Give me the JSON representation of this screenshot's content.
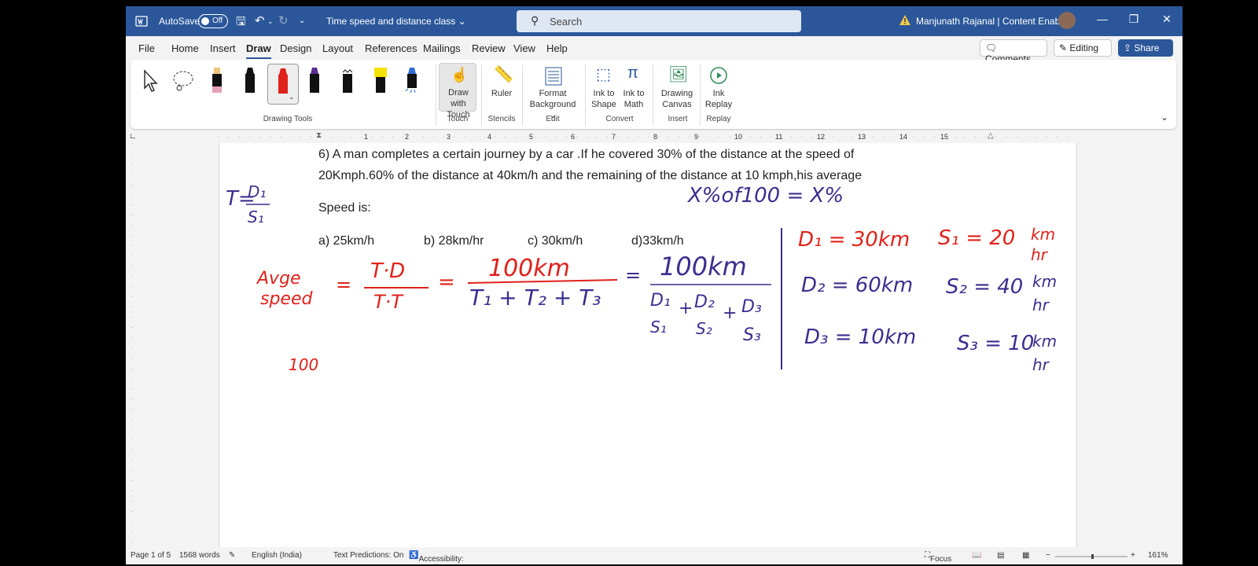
{
  "titlebar": {
    "autosave_label": "AutoSave",
    "autosave_state": "Off",
    "document_name": "Time speed and distance class",
    "search_placeholder": "Search",
    "user_name": "Manjunath Rajanal | Content Enablers"
  },
  "tabs": [
    "File",
    "Home",
    "Insert",
    "Draw",
    "Design",
    "Layout",
    "References",
    "Mailings",
    "Review",
    "View",
    "Help"
  ],
  "active_tab": "Draw",
  "actions": {
    "comments": "Comments",
    "editing": "Editing",
    "share": "Share"
  },
  "ribbon": {
    "groups": {
      "drawing_tools": "Drawing Tools",
      "touch": "Touch",
      "stencils": "Stencils",
      "edit": "Edit",
      "convert": "Convert",
      "insert": "Insert",
      "replay": "Replay"
    },
    "buttons": {
      "draw_with_touch": [
        "Draw with",
        "Touch"
      ],
      "ruler": "Ruler",
      "format_background": [
        "Format",
        "Background"
      ],
      "ink_to_shape": [
        "Ink to",
        "Shape"
      ],
      "ink_to_math": [
        "Ink to",
        "Math"
      ],
      "drawing_canvas": [
        "Drawing",
        "Canvas"
      ],
      "ink_replay": [
        "Ink",
        "Replay"
      ]
    },
    "pen_colors": [
      "#e8a0b8",
      "#111111",
      "#e0211a",
      "#5a2d91",
      "#111111",
      "#f2e400",
      "#2f6fd6"
    ]
  },
  "ruler_numbers": [
    "1",
    "2",
    "3",
    "4",
    "5",
    "6",
    "7",
    "8",
    "9",
    "10",
    "11",
    "12",
    "13",
    "14",
    "15"
  ],
  "document": {
    "question_line1": "6) A man completes a certain journey by a car .If he covered 30% of the distance at the speed of",
    "question_line2": "20Kmph.60% of the distance at 40km/h and the remaining of the distance at 10 kmph,his average",
    "question_line3": "Speed is:",
    "options": [
      "a) 25km/h",
      "b) 28km/hr",
      "c) 30km/h",
      "d)33km/h"
    ]
  },
  "ink": {
    "t_formula": [
      "T=",
      "D₁",
      "S₁"
    ],
    "percent_note": "X%of100 = X%",
    "avg_speed": [
      "Avge",
      "speed"
    ],
    "td_num": "T·D",
    "td_den": "T·T",
    "km100": "100km",
    "t_sum": "T₁ + T₂ + T₃",
    "d_over_s": [
      "D₁",
      "S₁",
      "D₂",
      "S₂",
      "D₃",
      "S₃"
    ],
    "d1": "D₁ = 30km",
    "s1": "S₁ = 20",
    "d2": "D₂ = 60km",
    "s2": "S₂ = 40",
    "d3": "D₃ = 10km",
    "s3": "S₃ = 10",
    "km_hr": [
      "km",
      "hr"
    ],
    "hundred": "100"
  },
  "status": {
    "page": "Page 1 of 5",
    "words": "1568 words",
    "language": "English (India)",
    "predictions": "Text Predictions: On",
    "accessibility": "Accessibility: Good to go",
    "focus": "Focus",
    "zoom": "161%"
  },
  "colors": {
    "title_bar": "#2b579a",
    "ink_red": "#e0211a",
    "ink_blue": "#3a2f8f"
  }
}
